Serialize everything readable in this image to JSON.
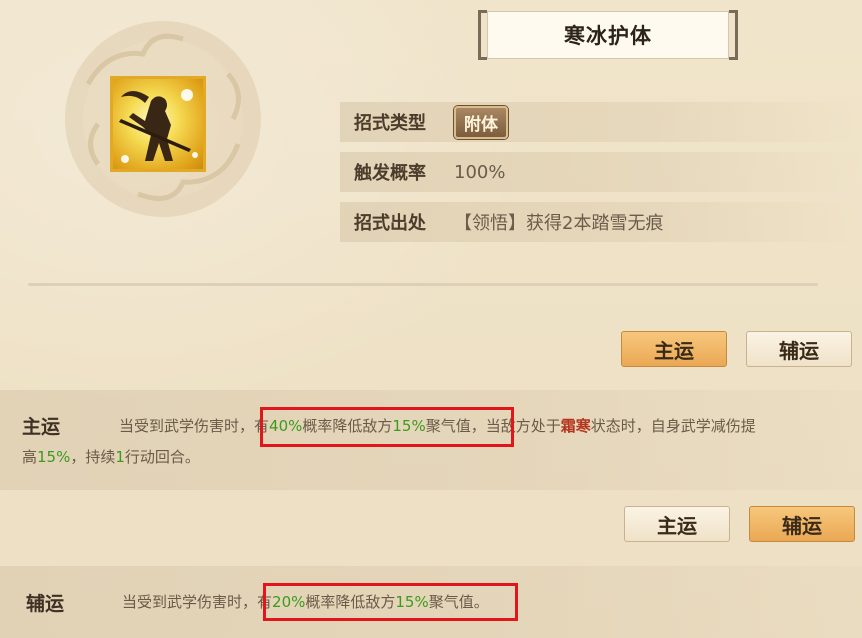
{
  "skill": {
    "title": "寒冰护体",
    "icon": "snow-warrior-icon"
  },
  "info": {
    "type_label": "招式类型",
    "type_value": "附体",
    "trigger_label": "触发概率",
    "trigger_value": "100%",
    "source_label": "招式出处",
    "source_value": "【领悟】获得2本踏雪无痕"
  },
  "buttons": {
    "main": "主运",
    "aux": "辅运"
  },
  "main_effect": {
    "name": "主运",
    "seg1": "当受到武学伤害时，",
    "seg2a": "有",
    "seg2b": "40%",
    "seg2c": "概率降低敌方",
    "seg2d": "15%",
    "seg2e": "聚气值",
    "seg3a": "，当敌方处于",
    "seg3b": "霜寒",
    "seg3c": "状态时，自身武学减伤提",
    "line2a": "高",
    "line2b": "15%",
    "line2c": "，持续",
    "line2d": "1",
    "line2e": "行动回合。"
  },
  "aux_effect": {
    "name": "辅运",
    "seg1": "当受到武学伤害时，",
    "seg2a": "有",
    "seg2b": "20%",
    "seg2c": "概率降低敌方",
    "seg2d": "15%",
    "seg2e": "聚气值。"
  },
  "colors": {
    "highlight": "#e0161a",
    "value_green": "#3d9a1c",
    "keyword_red": "#b3371f",
    "active_button": "#eaa854"
  }
}
